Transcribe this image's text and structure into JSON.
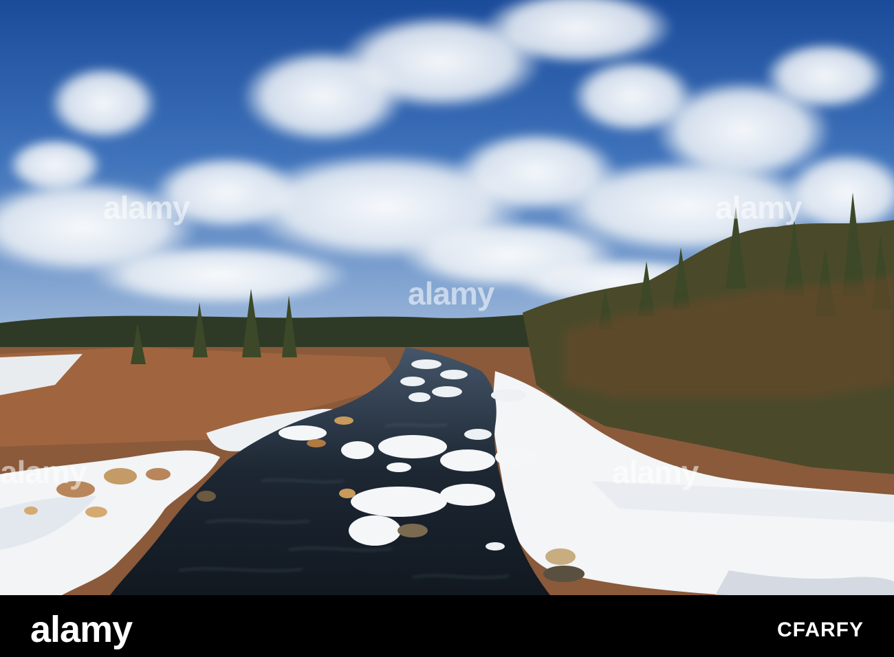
{
  "image": {
    "description_kind": "stock photo",
    "colors": {
      "sky_top": "#1d4f9e",
      "sky_bottom": "#8fb0d8",
      "cloud": "#f4f6f8",
      "forest": "#3e4a2c",
      "brush": "#8a4f2a",
      "snow": "#f3f5f7",
      "water": "#1b2430",
      "strip": "#000000"
    }
  },
  "watermark": {
    "logo_text": "alamy",
    "image_code": "CFARFY"
  }
}
